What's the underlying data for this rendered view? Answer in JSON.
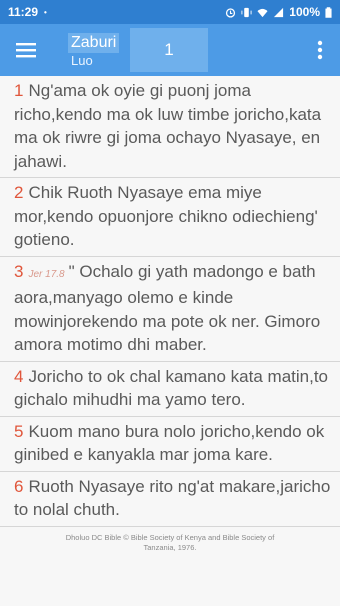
{
  "status_bar": {
    "time": "11:29",
    "dot": "•",
    "battery": "100%"
  },
  "toolbar": {
    "book_name": "Zaburi",
    "book_language": "Luo",
    "chapter": "1"
  },
  "verses": [
    {
      "num": "1",
      "text": "Ng'ama ok oyie gi puonj joma richo,kendo ma ok luw timbe joricho,kata ma ok riwre gi joma ochayo Nyasaye, en jahawi."
    },
    {
      "num": "2",
      "text": "Chik Ruoth Nyasaye ema miye mor,kendo opuonjore chikno odiechieng' gotieno."
    },
    {
      "num": "3",
      "xref": "Jer 17.8",
      "text": "\" Ochalo gi yath madongo e bath aora,manyago olemo e kinde mowinjorekendo ma pote ok ner. Gimoro amora motimo dhi maber."
    },
    {
      "num": "4",
      "text": "Joricho to ok chal kamano kata matin,to gichalo mihudhi ma yamo tero."
    },
    {
      "num": "5",
      "text": "Kuom mano bura nolo joricho,kendo ok ginibed e kanyakla mar joma kare."
    },
    {
      "num": "6",
      "text": "Ruoth Nyasaye rito ng'at makare,jaricho to nolal chuth."
    }
  ],
  "footer": "Dholuo DC Bible © Bible Society of Kenya and Bible Society of Tanzania, 1976.",
  "icons": [
    "menu-icon",
    "overflow-menu-icon",
    "alarm-icon",
    "vibrate-icon",
    "wifi-icon",
    "signal-icon",
    "battery-icon"
  ]
}
